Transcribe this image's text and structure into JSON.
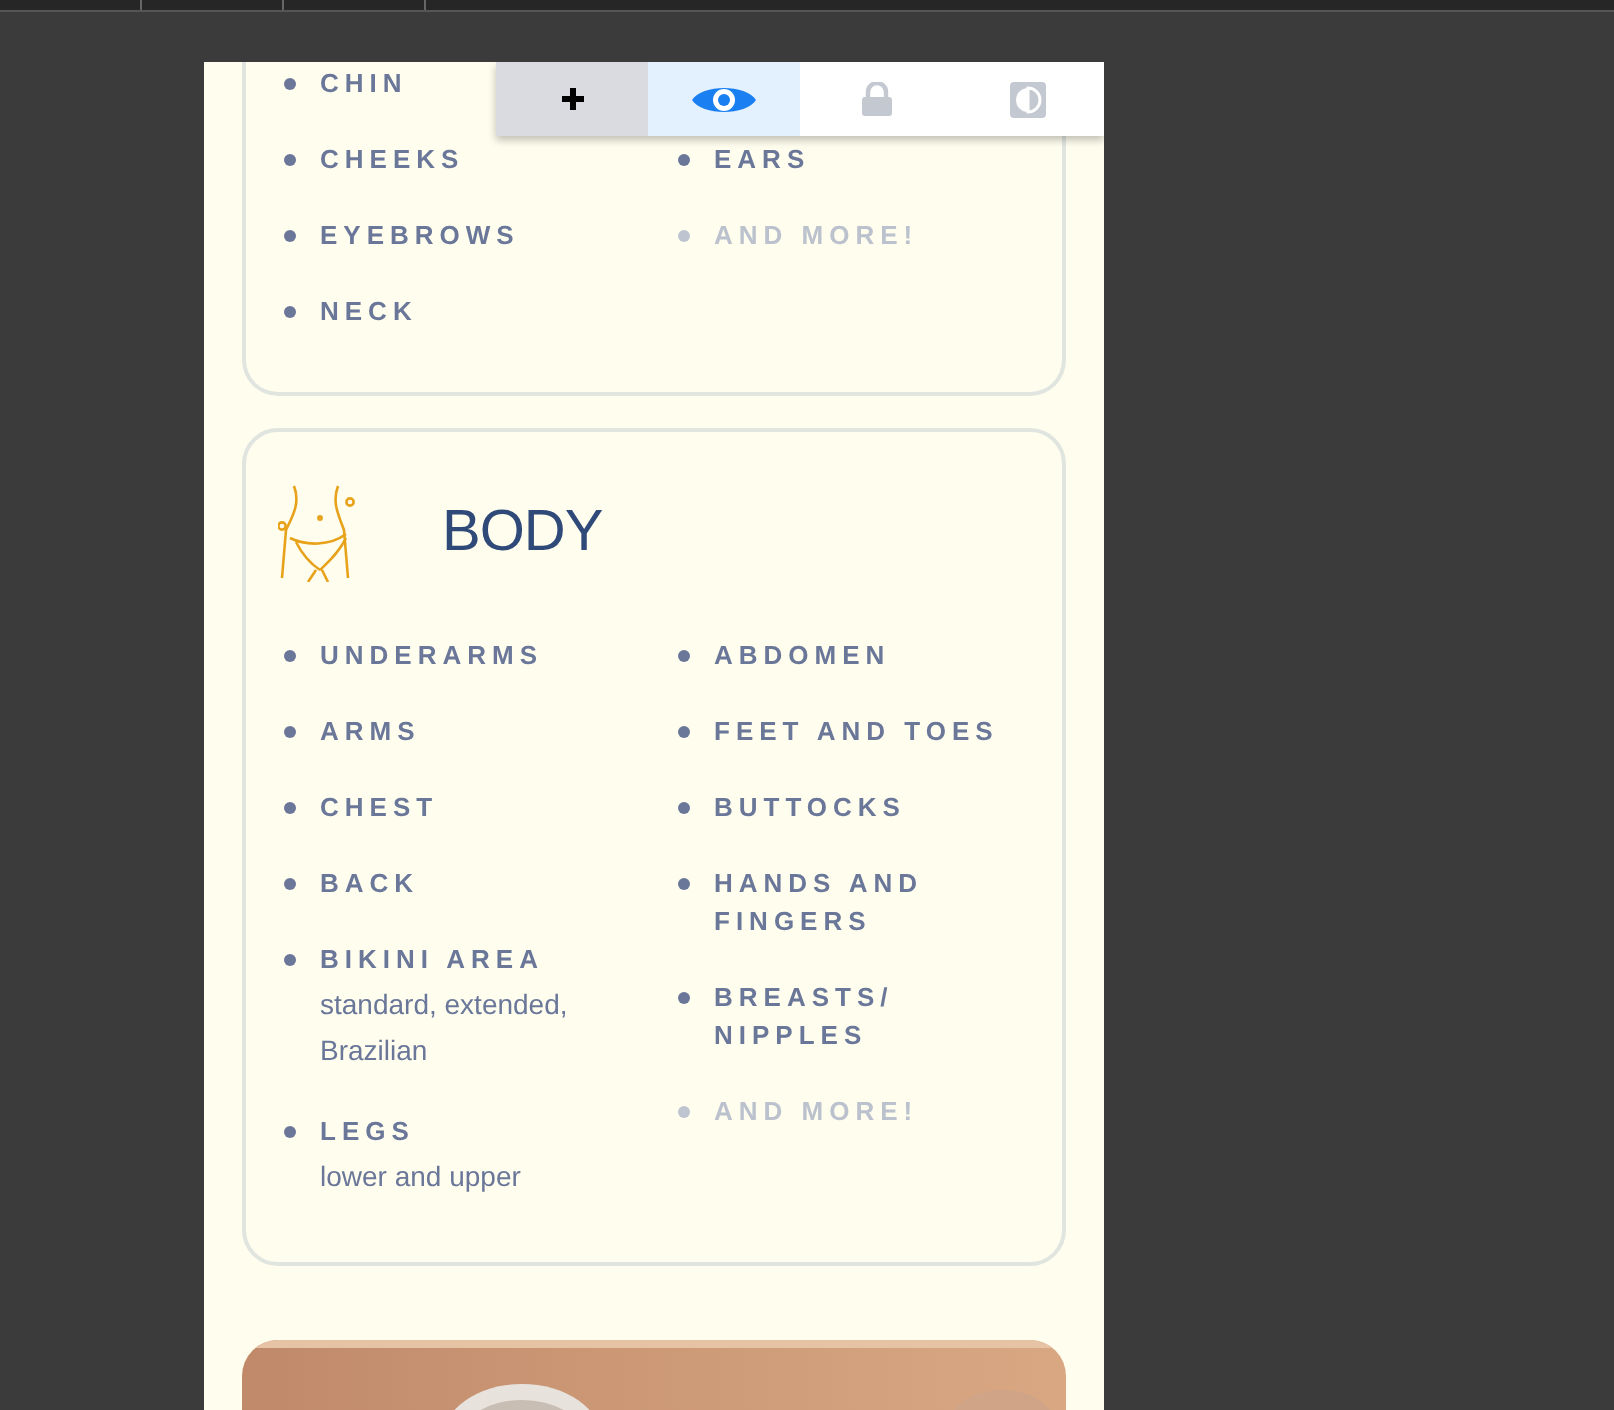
{
  "toolbar": {
    "buttons": [
      {
        "kind": "move",
        "selected": false,
        "highlighted": true
      },
      {
        "kind": "eye",
        "selected": true,
        "highlighted": false
      },
      {
        "kind": "lock",
        "selected": false,
        "highlighted": false
      },
      {
        "kind": "contrast",
        "selected": false,
        "highlighted": false
      }
    ]
  },
  "sections": [
    {
      "columns": [
        [
          {
            "label": "CHIN",
            "muted": false
          },
          {
            "label": "CHEEKS",
            "muted": false
          },
          {
            "label": "EYEBROWS",
            "muted": false
          },
          {
            "label": "NECK",
            "muted": false
          }
        ],
        [
          {
            "label": "EARS",
            "muted": false
          },
          {
            "label": "AND MORE!",
            "muted": true
          }
        ]
      ]
    },
    {
      "title": "BODY",
      "columns": [
        [
          {
            "label": "UNDERARMS",
            "muted": false
          },
          {
            "label": "ARMS",
            "muted": false
          },
          {
            "label": "CHEST",
            "muted": false
          },
          {
            "label": "BACK",
            "muted": false
          },
          {
            "label": "BIKINI AREA",
            "detail": "standard, extended, Brazilian",
            "muted": false
          },
          {
            "label": "LEGS",
            "detail": "lower and upper",
            "muted": false
          }
        ],
        [
          {
            "label": "ABDOMEN",
            "muted": false
          },
          {
            "label": "FEET AND TOES",
            "muted": false
          },
          {
            "label": "BUTTOCKS",
            "muted": false
          },
          {
            "label": "HANDS AND FINGERS",
            "muted": false
          },
          {
            "label": "BREASTS/ NIPPLES",
            "muted": false
          },
          {
            "label": "AND MORE!",
            "muted": true
          }
        ]
      ]
    }
  ]
}
